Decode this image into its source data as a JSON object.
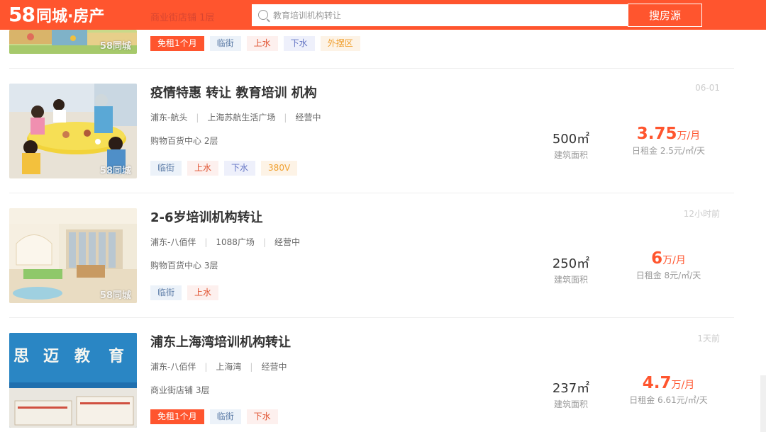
{
  "header": {
    "brand_num": "58",
    "brand_text": "同城·房产",
    "search_placeholder": "教育培训机构转让",
    "search_button": "搜房源",
    "faded_text": "商业街店铺 1层"
  },
  "colors": {
    "accent": "#ff552e"
  },
  "listings": [
    {
      "title": "",
      "tags": [
        "免租1个月",
        "临街",
        "上水",
        "下水",
        "外摆区"
      ]
    },
    {
      "title": "疫情特惠 转让 教育培训 机构",
      "district": "浦东-航头",
      "place": "上海苏航生活广场",
      "status": "经营中",
      "floor": "购物百货中心 2层",
      "tags": [
        "临街",
        "上水",
        "下水",
        "380V"
      ],
      "date": "06-01",
      "area": "500㎡",
      "area_label": "建筑面积",
      "price": "3.75",
      "price_unit": "万/月",
      "daily": "日租金 2.5元/㎡/天"
    },
    {
      "title": "2-6岁培训机构转让",
      "district": "浦东-八佰伴",
      "place": "1088广场",
      "status": "经营中",
      "floor": "购物百货中心 3层",
      "tags": [
        "临街",
        "上水"
      ],
      "date": "12小时前",
      "area": "250㎡",
      "area_label": "建筑面积",
      "price": "6",
      "price_unit": "万/月",
      "daily": "日租金 8元/㎡/天"
    },
    {
      "title": "浦东上海湾培训机构转让",
      "district": "浦东-八佰伴",
      "place": "上海湾",
      "status": "经营中",
      "floor": "商业街店铺 3层",
      "tags": [
        "免租1个月",
        "临街",
        "下水"
      ],
      "date": "1天前",
      "area": "237㎡",
      "area_label": "建筑面积",
      "price": "4.7",
      "price_unit": "万/月",
      "daily": "日租金 6.61元/㎡/天"
    }
  ],
  "watermark": "58同城"
}
